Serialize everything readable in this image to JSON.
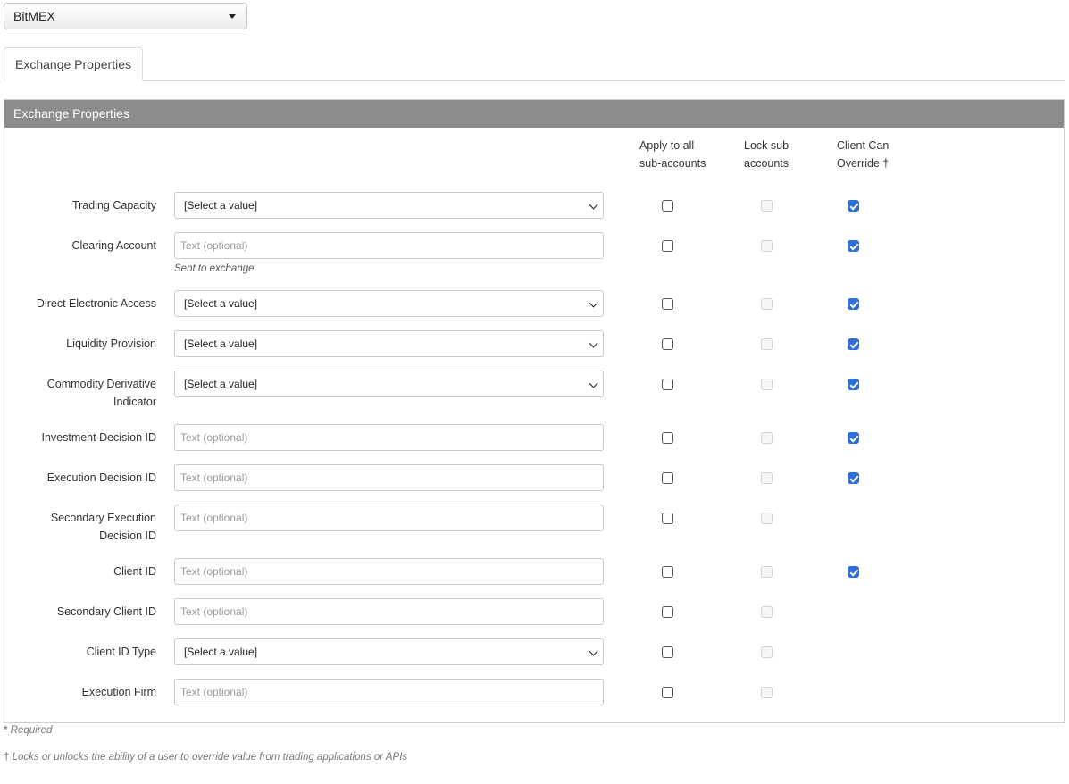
{
  "exchange_select": {
    "value": "BitMEX"
  },
  "tabs": [
    {
      "label": "Exchange Properties"
    }
  ],
  "panel": {
    "title": "Exchange Properties",
    "columns": {
      "apply": [
        "Apply to all",
        "sub-accounts"
      ],
      "lock": [
        "Lock sub-",
        "accounts"
      ],
      "override": [
        "Client Can",
        "Override †"
      ]
    },
    "rows": [
      {
        "label": [
          "Trading Capacity"
        ],
        "type": "select",
        "value": "[Select a value]",
        "override": true
      },
      {
        "label": [
          "Clearing Account"
        ],
        "type": "text",
        "value": "Text (optional)",
        "hint": "Sent to exchange",
        "override": true
      },
      {
        "label": [
          "Direct Electronic Access"
        ],
        "type": "select",
        "value": "[Select a value]",
        "override": true
      },
      {
        "label": [
          "Liquidity Provision"
        ],
        "type": "select",
        "value": "[Select a value]",
        "override": true
      },
      {
        "label": [
          "Commodity Derivative",
          "Indicator"
        ],
        "type": "select",
        "value": "[Select a value]",
        "override": true
      },
      {
        "label": [
          "Investment Decision ID"
        ],
        "type": "text",
        "value": "Text (optional)",
        "override": true
      },
      {
        "label": [
          "Execution Decision ID"
        ],
        "type": "text",
        "value": "Text (optional)",
        "override": true
      },
      {
        "label": [
          "Secondary Execution",
          "Decision ID"
        ],
        "type": "text",
        "value": "Text (optional)",
        "override": false
      },
      {
        "label": [
          "Client ID"
        ],
        "type": "text",
        "value": "Text (optional)",
        "override": true
      },
      {
        "label": [
          "Secondary Client ID"
        ],
        "type": "text",
        "value": "Text (optional)",
        "override": false
      },
      {
        "label": [
          "Client ID Type"
        ],
        "type": "select",
        "value": "[Select a value]",
        "override": false
      },
      {
        "label": [
          "Execution Firm"
        ],
        "type": "text",
        "value": "Text (optional)",
        "override": false
      }
    ]
  },
  "footnotes": {
    "required_mark": "*",
    "required_text": " Required",
    "dagger_mark": "†",
    "dagger_text": " Locks or unlocks the ability of a user to override value from trading applications or APIs"
  },
  "colors": {
    "checkbox_checked": "#2e6fd9",
    "panel_header_bg": "#8c8c8c"
  }
}
